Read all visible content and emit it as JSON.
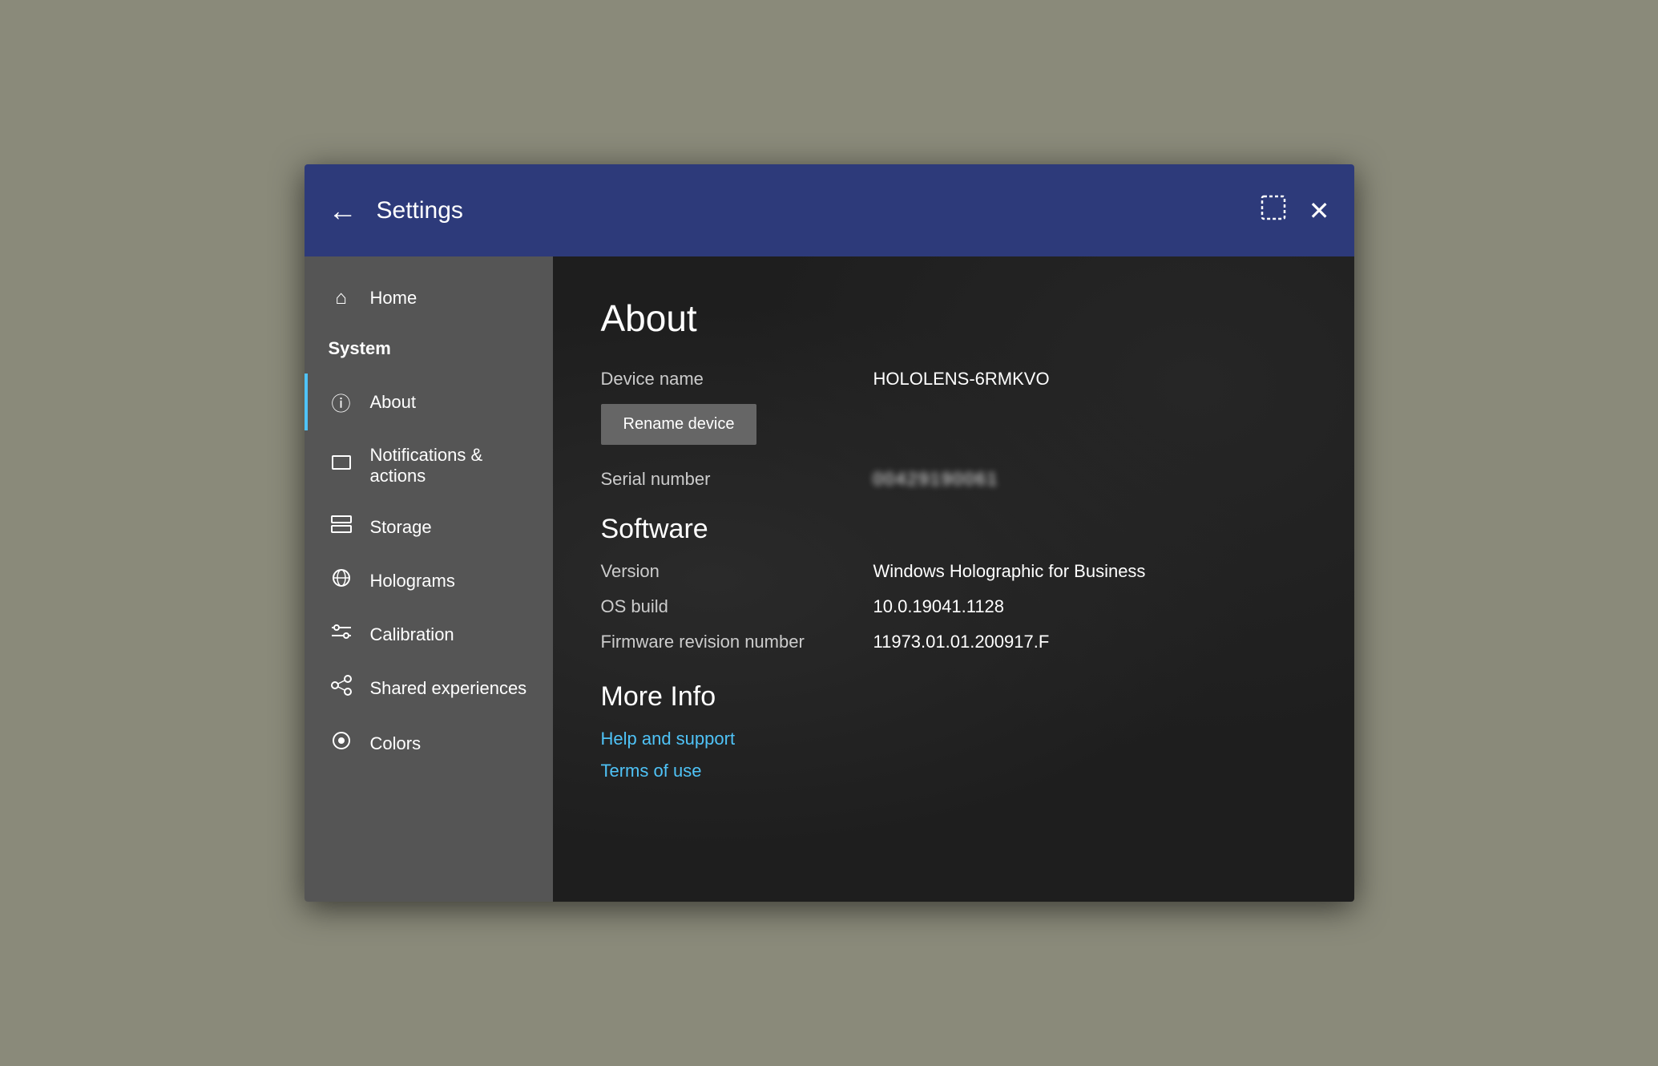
{
  "titlebar": {
    "back_label": "←",
    "title": "Settings",
    "window_icon_label": "⬜",
    "close_label": "✕"
  },
  "sidebar": {
    "home_label": "Home",
    "system_label": "System",
    "items": [
      {
        "id": "about",
        "label": "About",
        "icon": "ℹ",
        "active": true
      },
      {
        "id": "notifications",
        "label": "Notifications & actions",
        "icon": "🖥"
      },
      {
        "id": "storage",
        "label": "Storage",
        "icon": "🗄"
      },
      {
        "id": "holograms",
        "label": "Holograms",
        "icon": "✋"
      },
      {
        "id": "calibration",
        "label": "Calibration",
        "icon": "⚙"
      },
      {
        "id": "shared",
        "label": "Shared experiences",
        "icon": "⚡"
      },
      {
        "id": "colors",
        "label": "Colors",
        "icon": "🎨"
      }
    ]
  },
  "main": {
    "page_title": "About",
    "device_name_label": "Device name",
    "device_name_value": "HOLOLENS-6RMKVO",
    "rename_btn": "Rename device",
    "serial_number_label": "Serial number",
    "serial_number_value": "00429190061",
    "software_section": "Software",
    "version_label": "Version",
    "version_value": "Windows Holographic for Business",
    "os_build_label": "OS build",
    "os_build_value": "10.0.19041.1128",
    "firmware_label": "Firmware revision number",
    "firmware_value": "11973.01.01.200917.F",
    "more_info_section": "More Info",
    "help_link": "Help and support",
    "terms_link": "Terms of use"
  }
}
